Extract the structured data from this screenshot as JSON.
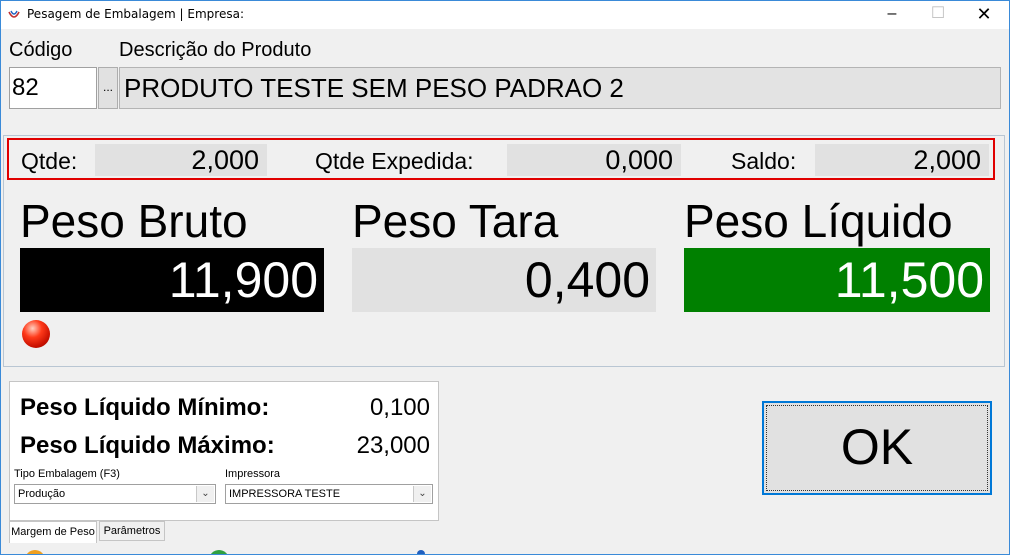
{
  "window": {
    "title": "Pesagem de Embalagem | Empresa:"
  },
  "product": {
    "codigo_label": "Código",
    "descricao_label": "Descrição do Produto",
    "codigo_value": "82",
    "lookup_label": "...",
    "descricao_value": "PRODUTO TESTE SEM PESO PADRAO 2"
  },
  "quantities": {
    "qtde_label": "Qtde:",
    "qtde_value": "2,000",
    "expedida_label": "Qtde Expedida:",
    "expedida_value": "0,000",
    "saldo_label": "Saldo:",
    "saldo_value": "2,000"
  },
  "weights": {
    "bruto_label": "Peso Bruto",
    "bruto_value": "11,900",
    "tara_label": "Peso Tara",
    "tara_value": "0,400",
    "liquido_label": "Peso Líquido",
    "liquido_value": "11,500"
  },
  "params": {
    "min_label": "Peso Líquido Mínimo:",
    "min_value": "0,100",
    "max_label": "Peso Líquido Máximo:",
    "max_value": "23,000",
    "tipo_label": "Tipo Embalagem (F3)",
    "tipo_value": "Produção",
    "impressora_label": "Impressora",
    "impressora_value": "IMPRESSORA TESTE",
    "tabs": [
      {
        "label": "Margem de Peso"
      },
      {
        "label": "Parâmetros"
      }
    ]
  },
  "actions": {
    "ok_label": "OK"
  },
  "colors": {
    "bruto_bg": "#000000",
    "tara_bg": "#e1e1e1",
    "liquido_bg": "#008000",
    "status_led": "#ff2a0a",
    "highlight_border": "#e00000"
  },
  "icons": {
    "app": "app-logo-icon",
    "minimize": "minimize-icon",
    "maximize": "maximize-icon",
    "close": "close-icon",
    "combo_arrow": "chevron-down-icon"
  }
}
